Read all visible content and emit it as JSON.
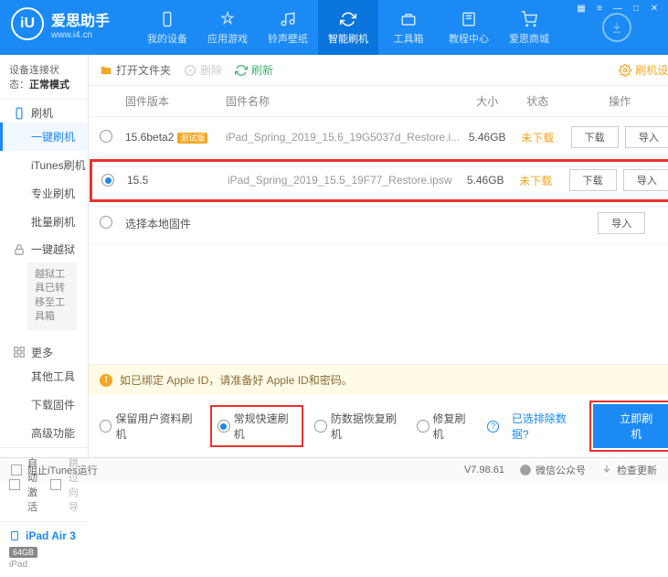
{
  "app": {
    "title": "爱思助手",
    "url": "www.i4.cn"
  },
  "nav": {
    "items": [
      {
        "label": "我的设备"
      },
      {
        "label": "应用游戏"
      },
      {
        "label": "铃声壁纸"
      },
      {
        "label": "智能刷机"
      },
      {
        "label": "工具箱"
      },
      {
        "label": "教程中心"
      },
      {
        "label": "爱思商城"
      }
    ]
  },
  "sidebar": {
    "conn_label": "设备连接状态：",
    "conn_value": "正常模式",
    "group_flash": "刷机",
    "flash_items": [
      "一键刷机",
      "iTunes刷机",
      "专业刷机",
      "批量刷机"
    ],
    "group_jail": "一键越狱",
    "jail_note": "越狱工具已转移至工具箱",
    "group_more": "更多",
    "more_items": [
      "其他工具",
      "下载固件",
      "高级功能"
    ],
    "auto_activate": "自动激活",
    "skip_guide": "跳过向导",
    "device_name": "iPad Air 3",
    "device_storage": "64GB",
    "device_type": "iPad"
  },
  "toolbar": {
    "open_folder": "打开文件夹",
    "delete": "删除",
    "refresh": "刷新",
    "settings": "刷机设置"
  },
  "table": {
    "headers": {
      "version": "固件版本",
      "name": "固件名称",
      "size": "大小",
      "status": "状态",
      "ops": "操作"
    },
    "rows": [
      {
        "version": "15.6beta2",
        "beta": "测试版",
        "name": "iPad_Spring_2019_15.6_19G5037d_Restore.i...",
        "size": "5.46GB",
        "status": "未下载",
        "selected": false
      },
      {
        "version": "15.5",
        "beta": "",
        "name": "iPad_Spring_2019_15.5_19F77_Restore.ipsw",
        "size": "5.46GB",
        "status": "未下载",
        "selected": true
      }
    ],
    "local_row": "选择本地固件",
    "btn_download": "下载",
    "btn_import": "导入"
  },
  "notice": {
    "text": "如已绑定 Apple ID，请准备好 Apple ID和密码。"
  },
  "modes": {
    "keep_data": "保留用户资料刷机",
    "normal": "常规快速刷机",
    "recovery": "防数据恢复刷机",
    "repair": "修复刷机",
    "exclude_link": "已选排除数据?",
    "flash_btn": "立即刷机"
  },
  "footer": {
    "block_itunes": "阻止iTunes运行",
    "version": "V7.98.61",
    "wechat": "微信公众号",
    "check_update": "检查更新"
  }
}
